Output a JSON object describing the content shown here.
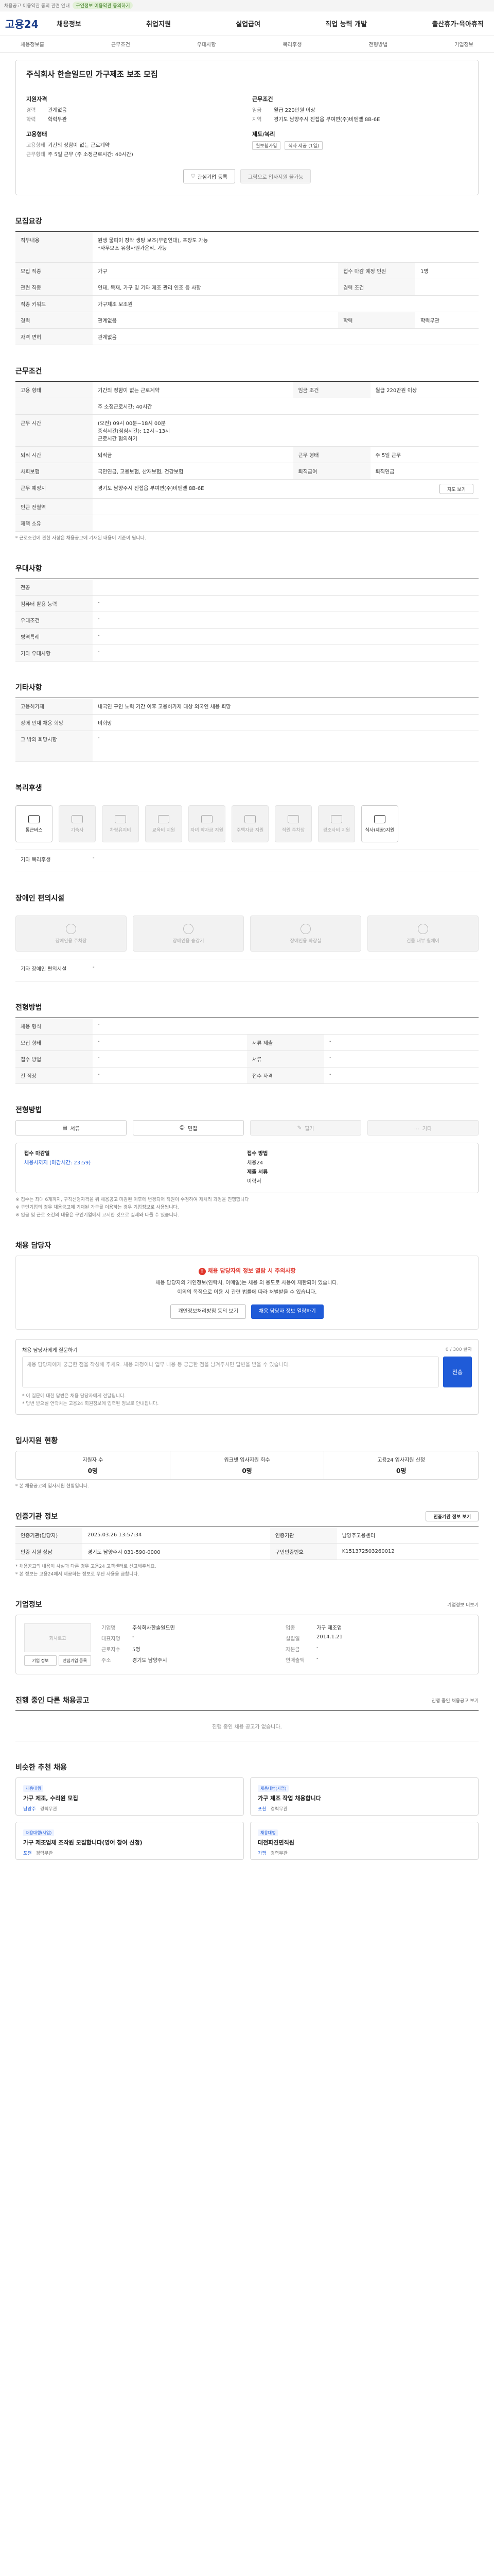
{
  "topbar": {
    "notice": "채용공고 이용약관 동의 관련 안내",
    "pill": "구인정보 이용약관 동의하기"
  },
  "gnb": {
    "logo": "고용24",
    "menu": [
      "채용정보",
      "취업지원",
      "실업급여",
      "직업 능력 개발",
      "출산휴가·육아휴직"
    ]
  },
  "subnav": [
    "채용정보홈",
    "근무조건",
    "우대사항",
    "복리후생",
    "전형방법",
    "기업정보"
  ],
  "job": {
    "title": "주식회사 한솔일드민 가구제조 보조 모집",
    "left_col_title": "지원자격",
    "left": [
      {
        "k": "경력",
        "v": "관계없음"
      },
      {
        "k": "학력",
        "v": "학력무관"
      }
    ],
    "emp_title": "고용형태",
    "emp": [
      {
        "k": "고용형태",
        "v": "기간의 정함이 없는 근로계약"
      },
      {
        "k": "근무형태",
        "v": "주 5일 근무 (주 소정근로시간: 40시간)"
      }
    ],
    "right_col_title": "근무조건",
    "right": [
      {
        "k": "임금",
        "v": "월급 220만원 이상"
      },
      {
        "k": "지역",
        "v": "경기도 남양주시 진접읍 부여면(주)비엔엘 8B-6E"
      }
    ],
    "benefit_title": "제도/복리",
    "chips": [
      "월보험가입",
      "식사 제공 (1일)"
    ],
    "btn_interest": "관심기업 등록",
    "btn_apply": "그림으로 입사지원 불가능"
  },
  "recruit": {
    "title": "모집요강",
    "job_desc_label": "직무내용",
    "job_desc": "원생 물피이 장착 생탕 보조(무렴연대), 포장도 가능\n*사무보조 유형사원가운적. 가능",
    "rows": [
      {
        "k": "모집 직종",
        "v": "가구",
        "k2": "접수 마감 예정 인원",
        "v2": "1명"
      },
      {
        "k": "관련 직종",
        "v": "인테, 목재, 가구 및 기타 제조 관리 인조 등 사항",
        "k2": "경력 조건",
        "v2": ""
      },
      {
        "k": "직종 키워드",
        "v": "가구제조 보조원",
        "k2": "",
        "v2": ""
      },
      {
        "k": "경력",
        "v": "관계없음",
        "k2": "학력",
        "v2": "학력무관"
      },
      {
        "k": "자격 면허",
        "v": "관계없음",
        "k2": "",
        "v2": ""
      }
    ]
  },
  "work": {
    "title": "근무조건",
    "rows": [
      {
        "k": "고용 형태",
        "v": "기간의 정함이 없는 근로계약",
        "k2": "임금 조건",
        "v2": "월급 220만원 이상"
      },
      {
        "k": "",
        "v": "주 소정근로시간: 40시간",
        "k2": "",
        "v2": ""
      },
      {
        "k": "근무 시간",
        "v": "(오전) 09시 00분~18시 00분\n중식시간(점심시간): 12시~13시\n근로시간 협의하기",
        "k2": "",
        "v2": ""
      },
      {
        "k": "퇴직 시간",
        "v": "퇴직금",
        "k2": "근무 형태",
        "v2": "주 5일 근무"
      },
      {
        "k": "사회보험",
        "v": "국민연금, 고용보험, 산재보험, 건강보험",
        "k2": "퇴직급여",
        "v2": "퇴직연금"
      },
      {
        "k": "근무 예정지",
        "v": "경기도 남양주시 진접읍 부여면(주)비엔엘 8B-6E",
        "k2": "",
        "v2": ""
      },
      {
        "k": "인근 전철역",
        "v": "",
        "k2": "",
        "v2": ""
      },
      {
        "k": "재택 소유",
        "v": "",
        "k2": "",
        "v2": ""
      }
    ],
    "map_btn": "지도 보기",
    "note": "* 근로조건에 관한 사항은 채용공고에 기재된 내용이 기준이 됩니다."
  },
  "pref": {
    "title": "우대사항",
    "rows": [
      {
        "k": "전공",
        "v": ""
      },
      {
        "k": "컴퓨터 활용 능력",
        "v": "-"
      },
      {
        "k": "우대조건",
        "v": "-"
      },
      {
        "k": "병역특례",
        "v": "-"
      },
      {
        "k": "기타 우대사항",
        "v": "-"
      }
    ]
  },
  "etc": {
    "title": "기타사항",
    "rows": [
      {
        "k": "고용허가제",
        "v": "내국인 구인 노력 기간 이후 고용허가제 대상 외국인 채용 희망"
      },
      {
        "k": "장애 인재 채용 희망",
        "v": "비희망"
      },
      {
        "k": "그 밖의 희망사항",
        "v": "-"
      }
    ]
  },
  "welfare": {
    "title": "복리후생",
    "items": [
      {
        "label": "통근버스",
        "on": true
      },
      {
        "label": "기숙사",
        "on": false
      },
      {
        "label": "차량유지비",
        "on": false
      },
      {
        "label": "교육비 지원",
        "on": false
      },
      {
        "label": "자녀 학자금 지원",
        "on": false
      },
      {
        "label": "주택자금 지원",
        "on": false
      },
      {
        "label": "직원 주차장",
        "on": false
      },
      {
        "label": "경조사비 지원",
        "on": false
      },
      {
        "label": "식사(제공)지원",
        "on": true
      }
    ],
    "free_label": "기타 복리후생",
    "free_value": "-"
  },
  "disability": {
    "title": "장애인 편의시설",
    "items": [
      "장애인용 주차장",
      "장애인용 승강기",
      "장애인용 화장실",
      "건물 내부 휠체어"
    ],
    "free_label": "기타 장애인 편의시설",
    "free_value": "-"
  },
  "selection": {
    "title": "전형방법",
    "rows": [
      {
        "k": "채용 형식",
        "v": "-",
        "k2": "",
        "v2": ""
      },
      {
        "k": "모집 형태",
        "v": "-",
        "k2": "서류 제출",
        "v2": "-"
      },
      {
        "k": "접수 방법",
        "v": "-",
        "k2": "서류",
        "v2": "-"
      },
      {
        "k": "전 직장",
        "v": "-",
        "k2": "접수 자격",
        "v2": "-"
      }
    ]
  },
  "method": {
    "title": "전형방법",
    "items": [
      {
        "label": "서류",
        "on": true
      },
      {
        "label": "면접",
        "on": true
      },
      {
        "label": "필기",
        "on": false
      },
      {
        "label": "기타",
        "on": false
      }
    ],
    "apply_label": "접수 마감일",
    "apply_value": "채용시까지 (마감시간: 23:59)",
    "method_label": "접수 방법",
    "method_value": "채용24",
    "doc_label": "제출 서류",
    "doc_value": "이력서",
    "notes": [
      "※ 접수는 최대 6개까지, 구직신청자격을 위 채용공고 마감된 이후에 변경되어 직원이 수정하여 재처리 과정을 진행합니다",
      "※ 구인기업의 경우 채용공고에 기재된 가구를 이용하는 경우 기업정보로 사용됩니다.",
      "※ 임금 및 근로 조건의 내용은 구인기업에서 고지한 것으로 실제와 다를 수 있습니다."
    ]
  },
  "warning": {
    "title": "채용 담당자",
    "heading": "채용 담당자의 정보 열람 시 주의사항",
    "lines": [
      "채용 담당자의 개인정보(연락처, 이메일)는 채용 외 용도로 사용이 제한되어 있습니다.",
      "이외의 목적으로 이용 시 관련 법률에 따라 처벌받을 수 있습니다."
    ],
    "btn_agree": "개인정보처리방침 동의 보기",
    "btn_view": "채용 담당자 정보 열람하기"
  },
  "inquiry": {
    "title": "채용 담당자에게 질문하기",
    "count": "0 / 300 글자",
    "placeholder": "채용 담당자에게 궁금한 점을 작성해 주세요. 채용 과정이나 업무 내용 등 궁금한 점을 남겨주시면 답변을 받을 수 있습니다.",
    "send": "전송",
    "notes": [
      "* 이 질문에 대한 답변은 채용 담당자에게 전달됩니다.",
      "* 답변 받으실 연락처는 고용24 회원정보에 입력된 정보로 안내됩니다."
    ]
  },
  "stats": {
    "title": "입사지원 현황",
    "cells": [
      {
        "label": "지원자 수",
        "value": "0명"
      },
      {
        "label": "워크넷 입사지원 회수",
        "value": "0명"
      },
      {
        "label": "고용24 입사지원 신청",
        "value": "0명"
      }
    ],
    "note": "* 본 채용공고의 입사지원 현황입니다."
  },
  "manager": {
    "title": "인증기관 정보",
    "right": "인증기관 정보 보기",
    "rows": [
      {
        "k": "인증기관(담당자)",
        "v": "2025.03.26 13:57:34",
        "k2": "인증기관",
        "v2": "남양주고용센터"
      },
      {
        "k": "인증 지원 상담",
        "v": "경기도 남양주시 031-590-0000",
        "k2": "구인인증번호",
        "v2": "K151372503260012"
      }
    ],
    "map_btn": "지도 보기",
    "notes": [
      "* 채용공고의 내용이 사실과 다른 경우 고용24 고객센터로 신고해주세요.",
      "* 본 정보는 고용24에서 제공하는 정보로 무단 사용을 금합니다."
    ]
  },
  "corp": {
    "title": "기업정보",
    "logo_alt": "회사로고",
    "btn_a": "기업 정보",
    "btn_b": "관심기업 등록",
    "rows": [
      {
        "k": "기업명",
        "v": "주식회사한솔일드민",
        "k2": "업종",
        "v2": "가구 제조업"
      },
      {
        "k": "대표자명",
        "v": "-",
        "k2": "설립일",
        "v2": "2014.1.21"
      },
      {
        "k": "근로자수",
        "v": "5명",
        "k2": "자본금",
        "v2": "-"
      },
      {
        "k": "주소",
        "v": "경기도 남양주시",
        "k2": "연매출액",
        "v2": "-"
      }
    ],
    "right_btn": "기업정보 더보기"
  },
  "ongoing": {
    "title": "진행 중인 다른 채용공고",
    "right": "진행 중인 채용공고 보기",
    "empty": "진행 중인 채용 공고가 없습니다."
  },
  "similar": {
    "title": "비슷한 추천 채용",
    "cards": [
      {
        "tag": "채용대행",
        "title": "가구 제조, 수리원 모집",
        "meta": [
          "남양주",
          "경력무관"
        ]
      },
      {
        "tag": "채용대행(사업)",
        "title": "가구 제조 작업 채용합니다",
        "meta": [
          "포천",
          "경력무관"
        ]
      },
      {
        "tag": "채용대행(사업)",
        "title": "가구 제조업체 조작원 모집합니다(영어 참여 신청)",
        "meta": [
          "포천",
          "경력무관"
        ]
      },
      {
        "tag": "채용대행",
        "title": "대전파견면직원",
        "meta": [
          "가평",
          "경력무관"
        ]
      }
    ]
  }
}
